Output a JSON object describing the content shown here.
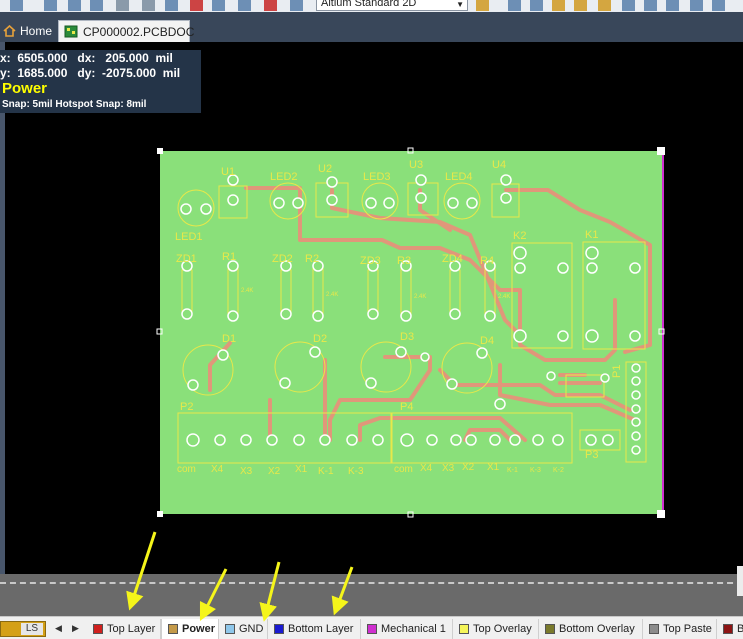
{
  "toolbar": {
    "view_mode": "Altium Standard 2D"
  },
  "tabs": [
    {
      "label": "Home",
      "active": false
    },
    {
      "label": "CP000002.PCBDOC *",
      "active": true
    }
  ],
  "hud": {
    "x_line": "x:  6505.000   dx:   205.000  mil",
    "y_line": "y:  1685.000   dy:  -2075.000  mil",
    "layer": "Power",
    "snap": "Snap: 5mil Hotspot Snap: 8mil"
  },
  "pcb": {
    "board_color": "#8ae07a",
    "trace_color": "#e0977a",
    "silk_color": "#e8e84a",
    "component_labels": [
      "U1",
      "LED2",
      "U2",
      "LED3",
      "U3",
      "LED4",
      "U4",
      "LED1",
      "K2",
      "K1",
      "ZD1",
      "R1",
      "ZD2",
      "R2",
      "ZD3",
      "R3",
      "ZD4",
      "R4",
      "D1",
      "D2",
      "D3",
      "D4",
      "P1",
      "P2",
      "P4",
      "P3"
    ],
    "pin_labels_left": [
      "com",
      "X4",
      "X3",
      "X2",
      "X1",
      "K-1",
      "K-3"
    ],
    "pin_labels_right": [
      "com",
      "X4",
      "X3",
      "X2",
      "X1",
      "K-1",
      "K-3",
      "K-2"
    ],
    "resistor_value": "2.4K"
  },
  "layer_selector": {
    "ls_label": "LS",
    "prev_icon": "chevron-left-icon",
    "next_icon": "chevron-right-icon"
  },
  "layers": [
    {
      "name": "Top Layer",
      "color": "#d0201e",
      "active": false
    },
    {
      "name": "Power",
      "color": "#c49a49",
      "active": true
    },
    {
      "name": "GND",
      "color": "#8fc7ea",
      "active": false
    },
    {
      "name": "Bottom Layer",
      "color": "#1a1ad0",
      "active": false
    },
    {
      "name": "Mechanical 1",
      "color": "#d030d0",
      "active": false
    },
    {
      "name": "Top Overlay",
      "color": "#f6f65a",
      "active": false
    },
    {
      "name": "Bottom Overlay",
      "color": "#7a7a2c",
      "active": false
    },
    {
      "name": "Top Paste",
      "color": "#8c8c8c",
      "active": false
    },
    {
      "name": "B",
      "color": "#8c1414",
      "active": false
    }
  ]
}
